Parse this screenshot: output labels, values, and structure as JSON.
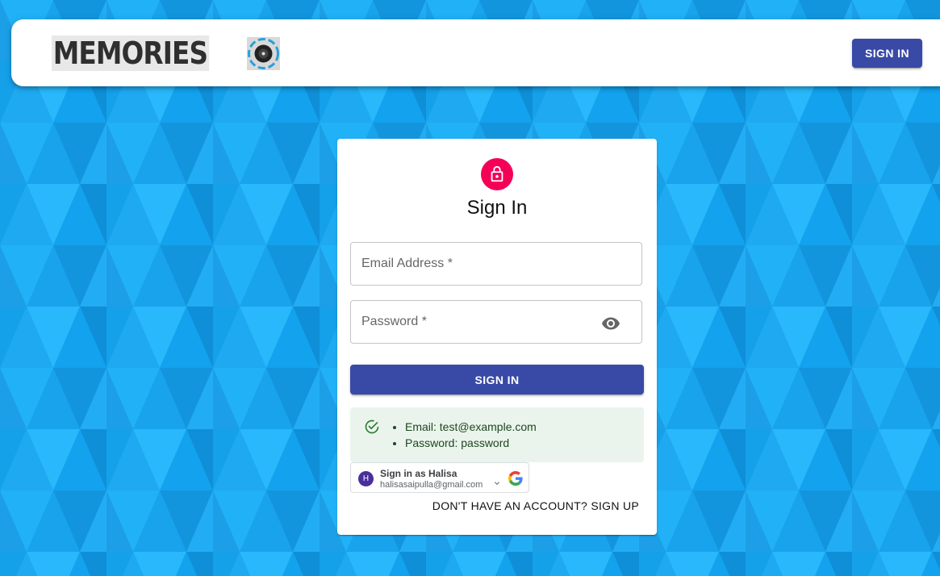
{
  "header": {
    "brand_text": "MEMORIES",
    "signin_label": "SIGN IN"
  },
  "signin_card": {
    "title": "Sign In",
    "email_label": "Email Address *",
    "password_label": "Password *",
    "submit_label": "SIGN IN",
    "hint_items": [
      "Email: test@example.com",
      "Password: password"
    ],
    "google": {
      "avatar_initial": "H",
      "title": "Sign in as Halisa",
      "email": "halisasaipulla@gmail.com"
    },
    "signup_link": "DON'T HAVE AN ACCOUNT? SIGN UP"
  },
  "colors": {
    "primary": "#3949a6",
    "avatar_bg": "#f50057",
    "background": "#1aa6ee",
    "success_bg": "#eaf4ec"
  },
  "icons": {
    "brand": "camera-lens-icon",
    "avatar": "lock-icon",
    "password": "eye-icon",
    "hint": "check-circle-icon",
    "google": "google-g-icon"
  }
}
